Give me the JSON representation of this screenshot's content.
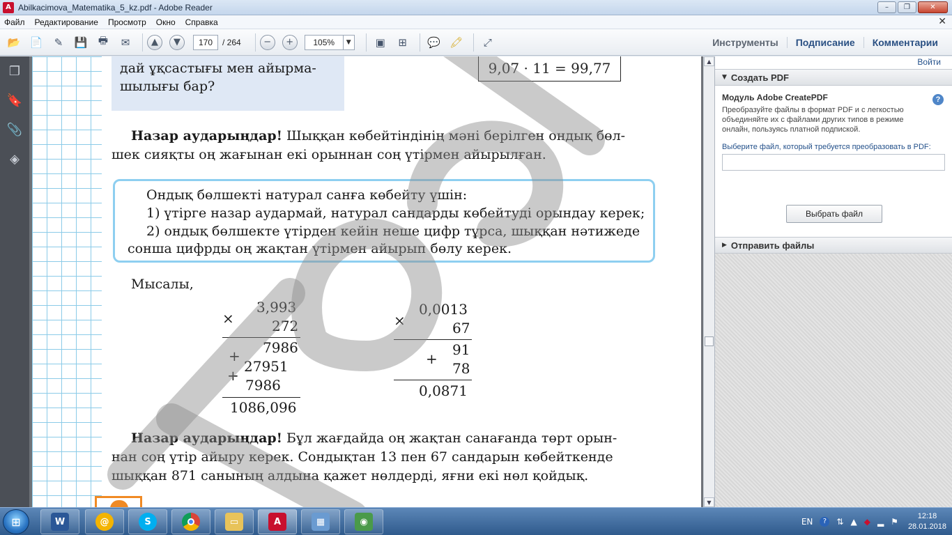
{
  "window": {
    "title": "Abilkacimova_Matematika_5_kz.pdf - Adobe Reader",
    "controls": [
      "–",
      "❐",
      "✕"
    ]
  },
  "menu": [
    "Файл",
    "Редактирование",
    "Просмотр",
    "Окно",
    "Справка"
  ],
  "menu_close": "✕",
  "toolbar": {
    "page_current": "170",
    "page_separator": "/ 264",
    "zoom": "105%",
    "zoom_minus": "−",
    "zoom_plus": "+",
    "right_links": [
      "Инструменты",
      "Подписание",
      "Комментарии"
    ]
  },
  "document": {
    "question_line1": "дай ұқсастығы мен айырма-",
    "question_line2": "шылығы бар?",
    "equation": "9,07 · 11 = 99,77",
    "attention1_bold": "Назар аударыңдар!",
    "attention1_rest": " Шыққан көбейтіндінің мәні берілген ондық бөл-",
    "attention1_line2": "шек сияқты оң жағынан екі орыннан соң үтірмен айырылған.",
    "rule_line1": "Ондық бөлшекті натурал санға көбейту үшін:",
    "rule_line2": "1) үтірге назар аудармай, натурал сандарды көбейтуді орындау керек;",
    "rule_line3": "2) ондық бөлшекте үтірден кейін неше цифр тұрса, шыққан нәтижеде",
    "rule_line4": "сонша цифрды оң жақтан үтірмен айырып бөлу керек.",
    "example_label": "Мысалы,",
    "calc1": {
      "times": "×",
      "a": "3,993",
      "b": "272",
      "plus": "+",
      "p1": "7986",
      "p2": "27951",
      "p3": "7986",
      "result": "1086,096"
    },
    "calc2": {
      "times": "×",
      "a": "0,0013",
      "b": "67",
      "plus": "+",
      "p1": "91",
      "p2": "78",
      "result": "0,0871"
    },
    "attention2_bold": "Назар аударыңдар!",
    "attention2_rest": " Бұл жағдайда оң жақтан санағанда төрт орын-",
    "attention2_line2": "нан соң үтір айыру керек. Сондықтан 13 пен 67 сандарын көбейткенде",
    "attention2_line3": "шыққан 871 санының алдына қажет нөлдерді, яғни екі нөл қойдық."
  },
  "right_panel": {
    "sign_in": "Войти",
    "section1_title": "Создать PDF",
    "module_title": "Модуль Adobe CreatePDF",
    "module_desc": "Преобразуйте файлы в формат PDF и с легкостью объединяйте их с файлами других типов в режиме онлайн, пользуясь платной подпиской.",
    "help": "?",
    "select_label": "Выберите файл, который требуется преобразовать в PDF:",
    "select_button": "Выбрать файл",
    "section2_title": "Отправить файлы"
  },
  "taskbar": {
    "tray_lang": "EN",
    "tray_help": "?",
    "time": "12:18",
    "date": "28.01.2018"
  },
  "colors": {
    "rule_border": "#8ecff0",
    "question_bg": "#dfe8f5",
    "link_blue": "#23508a",
    "accent_orange": "#f08a24"
  }
}
